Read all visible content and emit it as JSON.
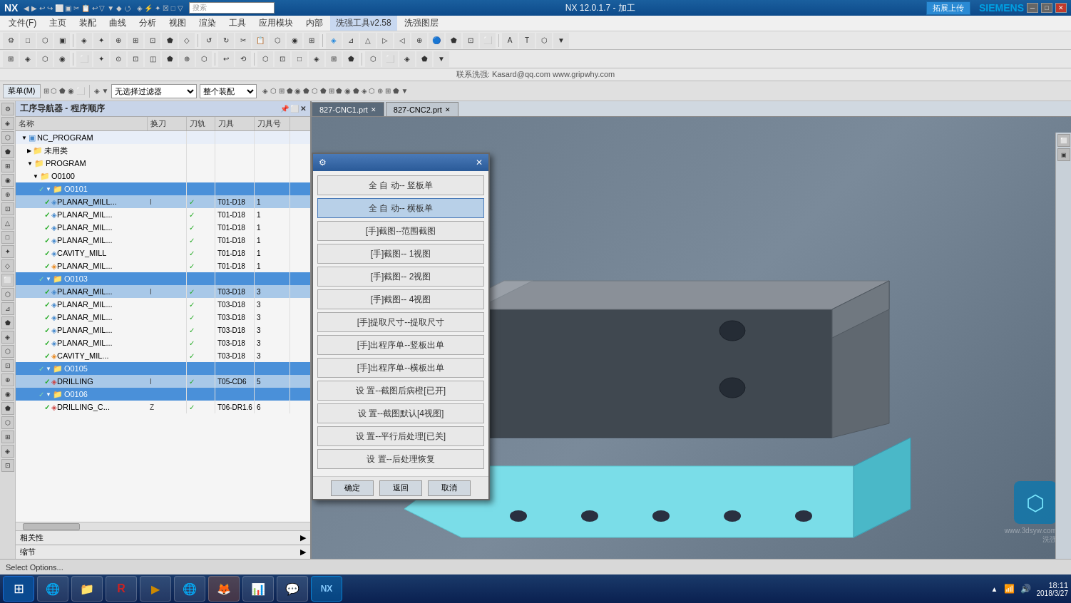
{
  "titlebar": {
    "logo": "NX",
    "title": "NX 12.0.1.7 - 加工",
    "siemens": "SIEMENS",
    "upload_btn": "拓展上传",
    "win_minimize": "─",
    "win_maximize": "□",
    "win_close": "✕"
  },
  "menubar": {
    "items": [
      "文件(F)",
      "主页",
      "装配",
      "曲线",
      "分析",
      "视图",
      "渲染",
      "工具",
      "应用模块",
      "内部",
      "洗强工具v2.58",
      "洗强图层"
    ]
  },
  "contactbar": {
    "text": "联系洗强: Kasard@qq.com  www.gripwhy.com"
  },
  "toolbar2": {
    "menu_label": "菜单(M)",
    "dropdown1": "无选择过滤器",
    "dropdown2": "整个装配"
  },
  "navigator": {
    "title": "工序导航器 - 程序顺序",
    "columns": [
      "名称",
      "换刀",
      "刀轨",
      "刀具",
      "刀具号"
    ],
    "tree": [
      {
        "level": 0,
        "name": "NC_PROGRAM",
        "type": "program",
        "check": "",
        "spindle": "",
        "tool": "",
        "toolnum": ""
      },
      {
        "level": 1,
        "name": "未用类",
        "type": "folder",
        "check": "",
        "spindle": "",
        "tool": "",
        "toolnum": ""
      },
      {
        "level": 1,
        "name": "PROGRAM",
        "type": "folder",
        "check": "",
        "spindle": "",
        "tool": "",
        "toolnum": ""
      },
      {
        "level": 2,
        "name": "O0100",
        "type": "folder",
        "check": "",
        "spindle": "",
        "tool": "",
        "toolnum": ""
      },
      {
        "level": 3,
        "name": "O0101",
        "type": "folder",
        "check": "✓",
        "selected": true,
        "spindle": "",
        "tool": "",
        "toolnum": ""
      },
      {
        "level": 4,
        "name": "PLANAR_MILL...",
        "type": "op",
        "check": "✓",
        "spindle": "I",
        "tool": "✓",
        "toolname": "T01-D18",
        "toolnum": "1"
      },
      {
        "level": 4,
        "name": "PLANAR_MIL...",
        "type": "op",
        "check": "✓",
        "spindle": "",
        "tool": "✓",
        "toolname": "T01-D18",
        "toolnum": "1"
      },
      {
        "level": 4,
        "name": "PLANAR_MIL...",
        "type": "op",
        "check": "✓",
        "spindle": "",
        "tool": "✓",
        "toolname": "T01-D18",
        "toolnum": "1"
      },
      {
        "level": 4,
        "name": "PLANAR_MIL...",
        "type": "op",
        "check": "✓",
        "spindle": "",
        "tool": "✓",
        "toolname": "T01-D18",
        "toolnum": "1"
      },
      {
        "level": 4,
        "name": "CAVITY_MILL",
        "type": "op",
        "check": "✓",
        "spindle": "",
        "tool": "✓",
        "toolname": "T01-D18",
        "toolnum": "1"
      },
      {
        "level": 4,
        "name": "PLANAR_MIL...",
        "type": "op",
        "check": "✓",
        "spindle": "",
        "tool": "✓",
        "toolname": "T01-D18",
        "toolnum": "1"
      },
      {
        "level": 3,
        "name": "O0103",
        "type": "folder",
        "check": "✓",
        "selected": true,
        "spindle": "",
        "tool": "",
        "toolnum": ""
      },
      {
        "level": 4,
        "name": "PLANAR_MIL...",
        "type": "op",
        "check": "✓",
        "spindle": "I",
        "tool": "✓",
        "toolname": "T03-D18",
        "toolnum": "3"
      },
      {
        "level": 4,
        "name": "PLANAR_MIL...",
        "type": "op",
        "check": "✓",
        "spindle": "",
        "tool": "✓",
        "toolname": "T03-D18",
        "toolnum": "3"
      },
      {
        "level": 4,
        "name": "PLANAR_MIL...",
        "type": "op",
        "check": "✓",
        "spindle": "",
        "tool": "✓",
        "toolname": "T03-D18",
        "toolnum": "3"
      },
      {
        "level": 4,
        "name": "PLANAR_MIL...",
        "type": "op",
        "check": "✓",
        "spindle": "",
        "tool": "✓",
        "toolname": "T03-D18",
        "toolnum": "3"
      },
      {
        "level": 4,
        "name": "PLANAR_MIL...",
        "type": "op",
        "check": "✓",
        "spindle": "",
        "tool": "✓",
        "toolname": "T03-D18",
        "toolnum": "3"
      },
      {
        "level": 4,
        "name": "PLANAR_MIL...",
        "type": "op",
        "check": "✓",
        "spindle": "",
        "tool": "✓",
        "toolname": "T03-D18",
        "toolnum": "3"
      },
      {
        "level": 4,
        "name": "CAVITY_MIL...",
        "type": "op",
        "check": "✓",
        "spindle": "",
        "tool": "✓",
        "toolname": "T03-D18",
        "toolnum": "3"
      },
      {
        "level": 3,
        "name": "O0105",
        "type": "folder",
        "check": "✓",
        "selected": true,
        "spindle": "",
        "tool": "",
        "toolnum": ""
      },
      {
        "level": 4,
        "name": "DRILLING",
        "type": "op",
        "check": "✓",
        "spindle": "I",
        "tool": "✓",
        "toolname": "T05-CD6",
        "toolnum": "5"
      },
      {
        "level": 3,
        "name": "O0106",
        "type": "folder",
        "check": "✓",
        "selected": true,
        "spindle": "",
        "tool": "",
        "toolnum": ""
      },
      {
        "level": 4,
        "name": "DRILLING_C...",
        "type": "op",
        "check": "✓",
        "spindle": "Z",
        "tool": "✓",
        "toolname": "T06-DR1.6",
        "toolnum": "6"
      }
    ],
    "relations_label": "相关性",
    "zoom_label": "缩节"
  },
  "tabs": [
    {
      "label": "827-CNC1.prt",
      "active": true
    },
    {
      "label": "827-CNC2.prt",
      "active": false
    }
  ],
  "dialog": {
    "title": "⚙",
    "close": "✕",
    "buttons": [
      {
        "label": "全 自 动-- 竖板单",
        "active": false
      },
      {
        "label": "全 自 动-- 横板单",
        "active": true
      },
      {
        "label": "[手]截图--范围截图",
        "active": false
      },
      {
        "label": "[手]截图-- 1视图",
        "active": false
      },
      {
        "label": "[手]截图-- 2视图",
        "active": false
      },
      {
        "label": "[手]截图-- 4视图",
        "active": false
      },
      {
        "label": "[手]提取尺寸--提取尺寸",
        "active": false
      },
      {
        "label": "[手]出程序单--竖板出单",
        "active": false
      },
      {
        "label": "[手]出程序单--横板出单",
        "active": false
      },
      {
        "label": "设 置--截图后病橙[已开]",
        "active": false
      },
      {
        "label": "设 置--截图默认[4视图]",
        "active": false
      },
      {
        "label": "设 置--平行后处理[已关]",
        "active": false
      },
      {
        "label": "设 置--后处理恢复",
        "active": false
      }
    ],
    "confirm": "确定",
    "back": "返回",
    "cancel": "取消"
  },
  "statusbar": {
    "text": "Select Options..."
  },
  "taskbar": {
    "apps": [
      "⊞",
      "🌐",
      "📁",
      "🔴",
      "▶",
      "🌐",
      "🦊",
      "📊",
      "💬",
      "🔧"
    ]
  },
  "tray": {
    "text": "▲ ♦ 📶 🔊",
    "time": "18:11",
    "date": "2018/3/27"
  }
}
